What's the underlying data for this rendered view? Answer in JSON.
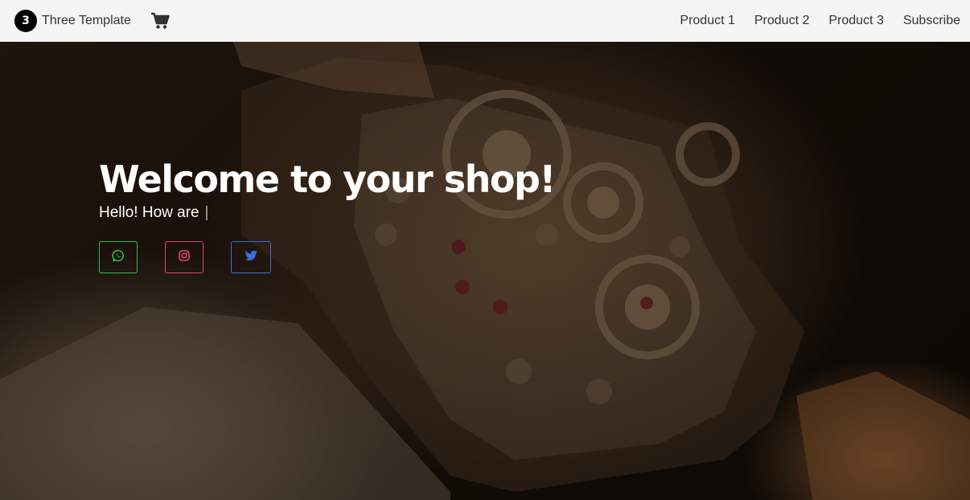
{
  "navbar": {
    "brand_badge": "3",
    "brand_name": "Three Template",
    "cart_icon": "cart-icon",
    "links": [
      {
        "label": "Product 1"
      },
      {
        "label": "Product 2"
      },
      {
        "label": "Product 3"
      },
      {
        "label": "Subscribe"
      }
    ]
  },
  "hero": {
    "title": "Welcome to your shop!",
    "subtitle": "Hello! How are",
    "socials": [
      {
        "icon": "whatsapp-icon",
        "color": "#2fbe4a"
      },
      {
        "icon": "instagram-icon",
        "color": "#e0476a"
      },
      {
        "icon": "twitter-icon",
        "color": "#3a6fd8"
      }
    ]
  }
}
